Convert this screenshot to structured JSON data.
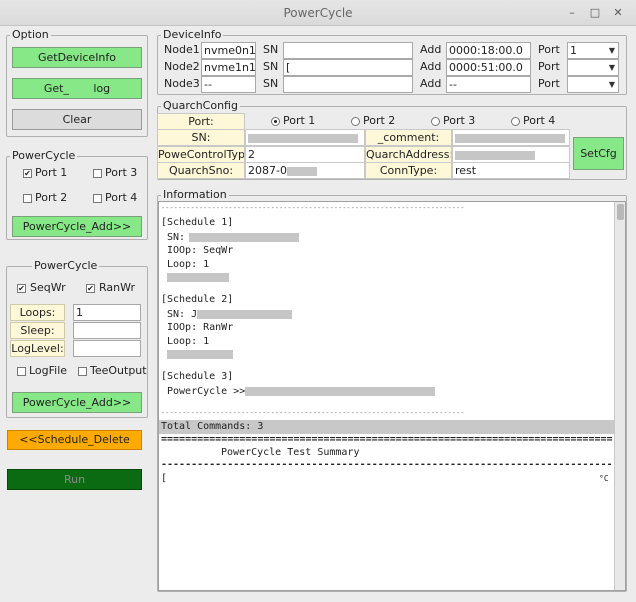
{
  "window": {
    "title": "PowerCycle",
    "min": "–",
    "max": "□",
    "close": "✕"
  },
  "option": {
    "label": "Option",
    "get_device_info": "GetDeviceInfo",
    "get_log": "Get_       log",
    "clear": "Clear"
  },
  "powercycle1": {
    "label": "PowerCycle",
    "ports": [
      "Port 1",
      "Port 2",
      "Port 3",
      "Port 4"
    ],
    "port1_checked": "✔",
    "add": "PowerCycle_Add>>"
  },
  "powercycle2": {
    "label": "PowerCycle",
    "seqwr": "SeqWr",
    "ranwr": "RanWr",
    "seqwr_checked": "✔",
    "ranwr_checked": "✔",
    "loops_label": "Loops:",
    "loops_value": "1",
    "sleep_label": "Sleep:",
    "sleep_value": "",
    "loglevel_label": "LogLevel:",
    "loglevel_value": "",
    "logfile": "LogFile",
    "teeoutput": "TeeOutput",
    "add": "PowerCycle_Add>>"
  },
  "schedule_delete": "<<Schedule_Delete",
  "run": "Run",
  "deviceinfo": {
    "label": "DeviceInfo",
    "sn_label": "SN",
    "add_label": "Add",
    "port_label": "Port",
    "nodes": [
      {
        "label": "Node1",
        "dev": "nvme0n1",
        "sn": "",
        "add": "0000:18:00.0",
        "port": "1"
      },
      {
        "label": "Node2",
        "dev": "nvme1n1",
        "sn": "[",
        "add": "0000:51:00.0",
        "port": ""
      },
      {
        "label": "Node3",
        "dev": "--",
        "sn": "",
        "add": "--",
        "port": ""
      }
    ]
  },
  "quarch": {
    "label": "QuarchConfig",
    "port_label": "Port:",
    "ports": [
      "Port 1",
      "Port 2",
      "Port 3",
      "Port 4"
    ],
    "sn_label": "SN:",
    "sn_value": "",
    "comment_label": "_comment:",
    "comment_value": "",
    "powectl_label": "PoweControlType:",
    "powectl_value": "2",
    "address_label": "QuarchAddress:",
    "address_value": "",
    "sno_label": "QuarchSno:",
    "sno_value": "2087-0",
    "conntype_label": "ConnType:",
    "conntype_value": "rest",
    "setcfg": "SetCfg"
  },
  "information": {
    "label": "Information",
    "divider": "------------------------------------------------------------------------",
    "s1_title": "[Schedule 1]",
    "s1_sn": "SN:",
    "s1_ioop": "IOOp: SeqWr",
    "s1_loop": "Loop: 1",
    "s2_title": "[Schedule 2]",
    "s2_sn": "SN: J",
    "s2_ioop": "IOOp: RanWr",
    "s2_loop": "Loop: 1",
    "s3_title": "[Schedule 3]",
    "s3_pc": "PowerCycle >>",
    "total": "Total Commands: 3",
    "eq_line": "==================================================================================",
    "summary": "PowerCycle Test Summary",
    "dash_line": "--------------------------------------------------------------------------------------------------",
    "row_left": "[",
    "row_right": "°C"
  },
  "colors": {
    "green": "#86e886",
    "orange": "#ffaa00",
    "run": "#0b6b12",
    "yellow": "#fff8d8"
  }
}
